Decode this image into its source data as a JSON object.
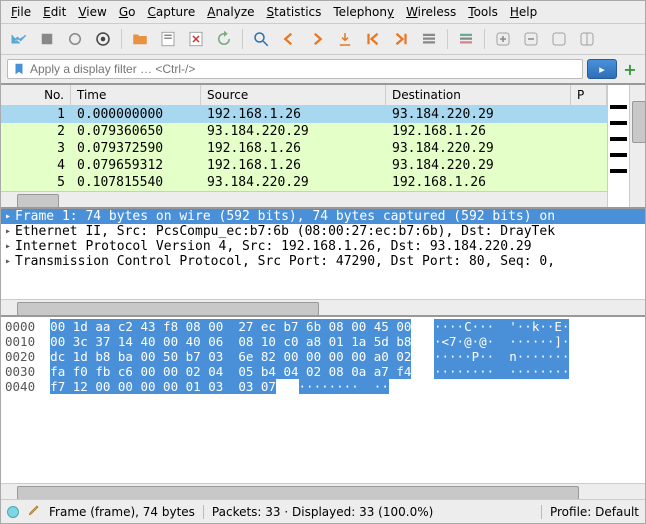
{
  "menu": {
    "file": "File",
    "edit": "Edit",
    "view": "View",
    "go": "Go",
    "capture": "Capture",
    "analyze": "Analyze",
    "statistics": "Statistics",
    "telephony": "Telephony",
    "wireless": "Wireless",
    "tools": "Tools",
    "help": "Help"
  },
  "filter": {
    "placeholder": "Apply a display filter … <Ctrl-/>"
  },
  "packet_list": {
    "columns": {
      "no": "No.",
      "time": "Time",
      "source": "Source",
      "destination": "Destination",
      "protocol": "P"
    },
    "rows": [
      {
        "no": "1",
        "time": "0.000000000",
        "src": "192.168.1.26",
        "dst": "93.184.220.29",
        "sel": true
      },
      {
        "no": "2",
        "time": "0.079360650",
        "src": "93.184.220.29",
        "dst": "192.168.1.26",
        "sel": false
      },
      {
        "no": "3",
        "time": "0.079372590",
        "src": "192.168.1.26",
        "dst": "93.184.220.29",
        "sel": false
      },
      {
        "no": "4",
        "time": "0.079659312",
        "src": "192.168.1.26",
        "dst": "93.184.220.29",
        "sel": false
      },
      {
        "no": "5",
        "time": "0.107815540",
        "src": "93.184.220.29",
        "dst": "192.168.1.26",
        "sel": false
      }
    ]
  },
  "details": {
    "lines": [
      {
        "text": "Frame 1: 74 bytes on wire (592 bits), 74 bytes captured (592 bits) on",
        "sel": true
      },
      {
        "text": "Ethernet II, Src: PcsCompu_ec:b7:6b (08:00:27:ec:b7:6b), Dst: DrayTek",
        "sel": false
      },
      {
        "text": "Internet Protocol Version 4, Src: 192.168.1.26, Dst: 93.184.220.29",
        "sel": false
      },
      {
        "text": "Transmission Control Protocol, Src Port: 47290, Dst Port: 80, Seq: 0,",
        "sel": false
      }
    ]
  },
  "hex": {
    "rows": [
      {
        "off": "0000",
        "b": "00 1d aa c2 43 f8 08 00  27 ec b7 6b 08 00 45 00",
        "a": "····C···  '··k··E·"
      },
      {
        "off": "0010",
        "b": "00 3c 37 14 40 00 40 06  08 10 c0 a8 01 1a 5d b8",
        "a": "·<7·@·@·  ······]·"
      },
      {
        "off": "0020",
        "b": "dc 1d b8 ba 00 50 b7 03  6e 82 00 00 00 00 a0 02",
        "a": "·····P··  n·······"
      },
      {
        "off": "0030",
        "b": "fa f0 fb c6 00 00 02 04  05 b4 04 02 08 0a a7 f4",
        "a": "········  ········"
      },
      {
        "off": "0040",
        "b": "f7 12 00 00 00 00 01 03  03 07",
        "a": "········  ··",
        "short": true
      }
    ]
  },
  "status": {
    "frame": "Frame (frame), 74 bytes",
    "packets": "Packets: 33 · Displayed: 33 (100.0%)",
    "profile": "Profile: Default"
  }
}
